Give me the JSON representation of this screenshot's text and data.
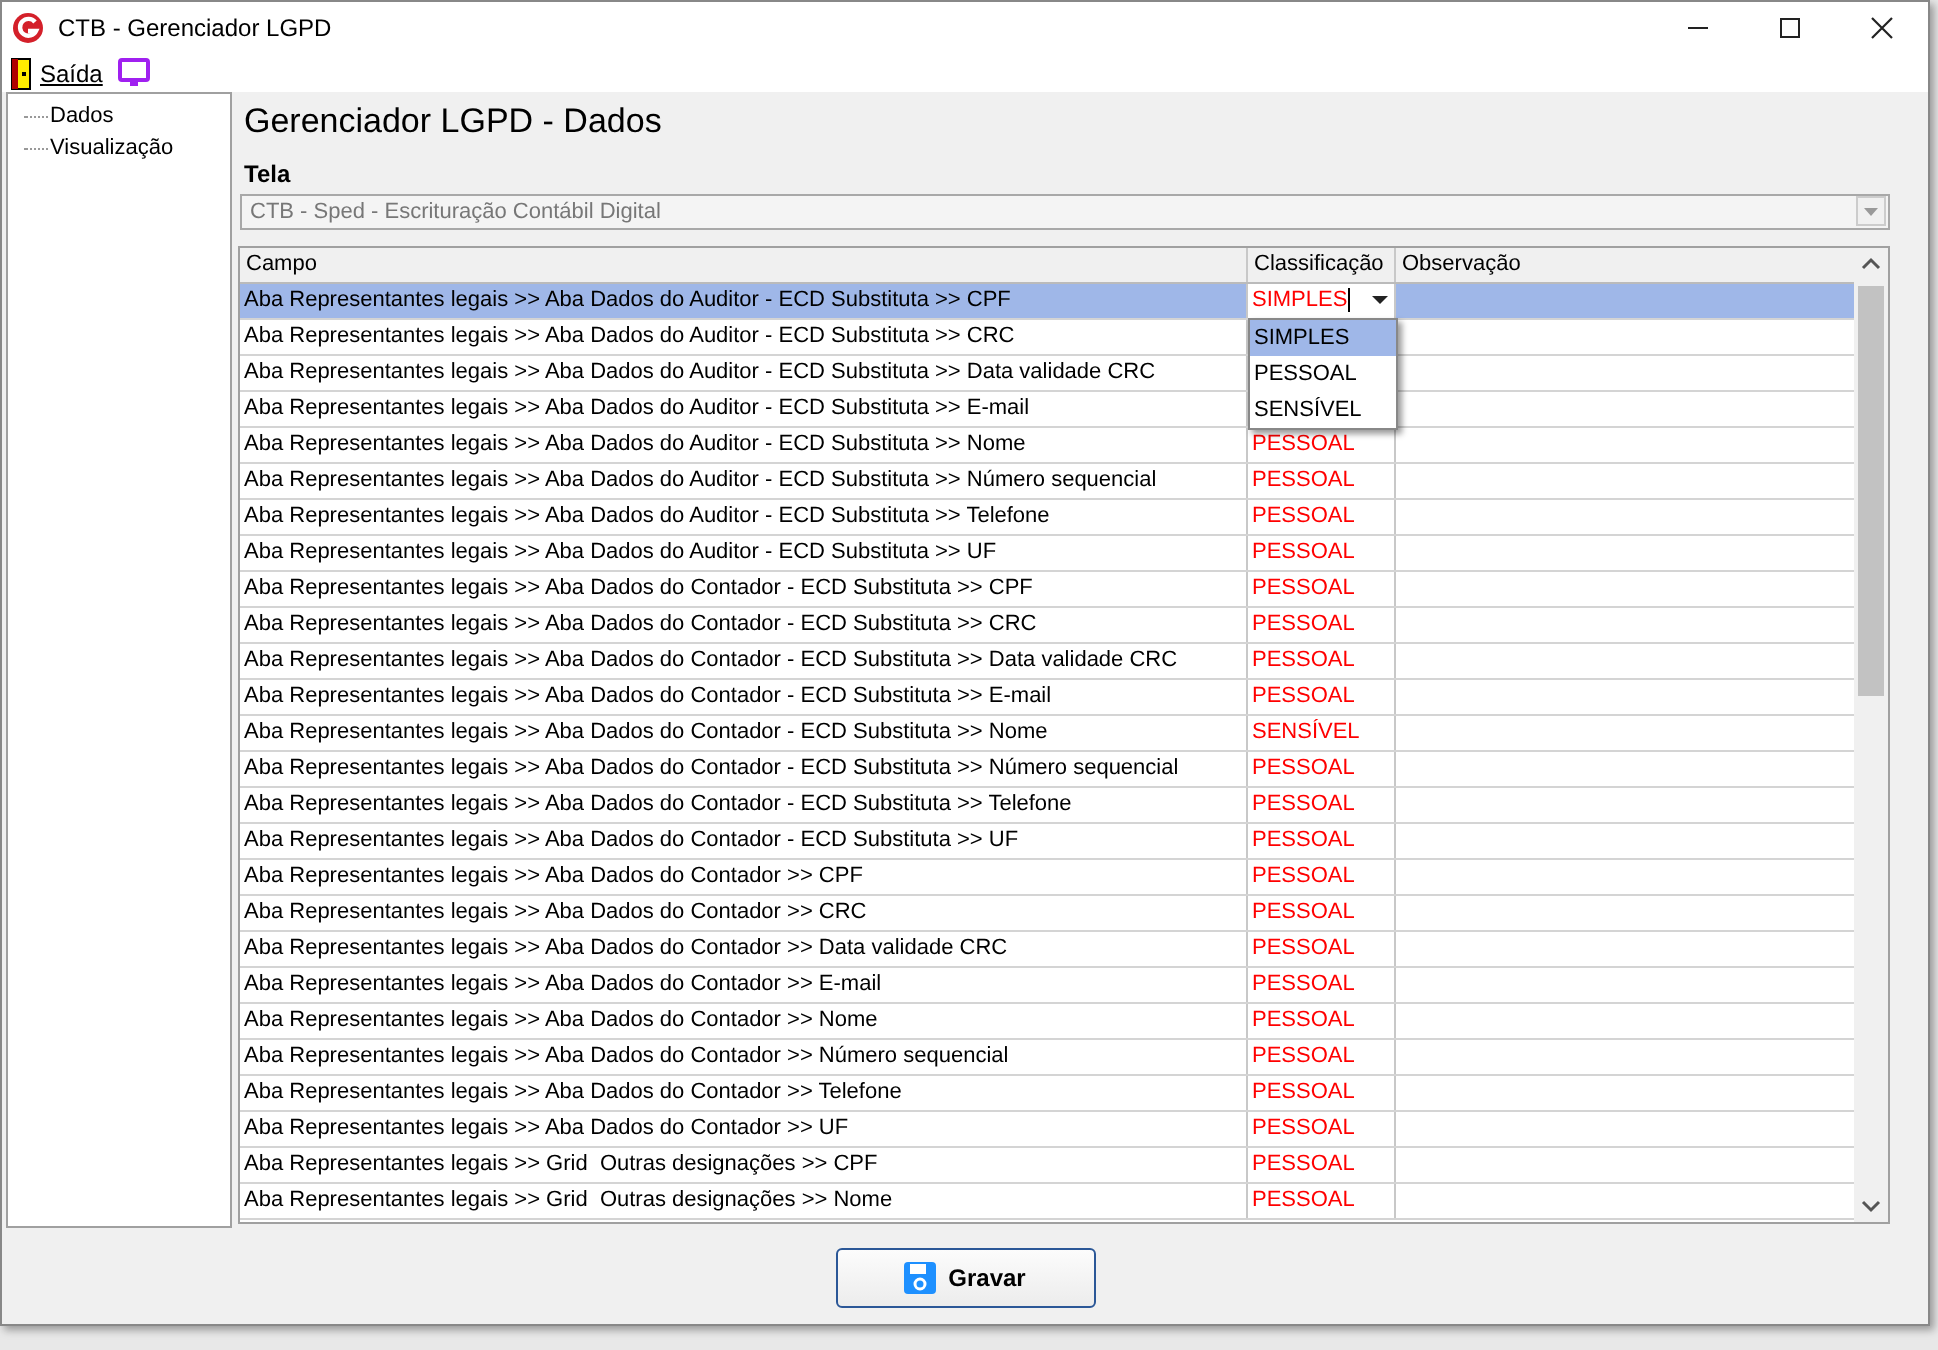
{
  "window": {
    "title": "CTB - Gerenciador LGPD"
  },
  "menu": [
    {
      "label": "Saída",
      "kind": "exit"
    },
    {
      "kind": "screen"
    }
  ],
  "sidebar": {
    "items": [
      {
        "label": "Dados",
        "selected": false
      },
      {
        "label": "Visualização",
        "selected": false
      }
    ]
  },
  "heading": "Gerenciador LGPD - Dados",
  "tela": {
    "label": "Tela",
    "value": "CTB - Sped - Escrituração Contábil Digital",
    "disabled": true
  },
  "table": {
    "columns": [
      "Campo",
      "Classificação",
      "Observação"
    ],
    "rows": [
      {
        "campo": "Aba Representantes legais >> Aba Dados do Auditor - ECD Substituta >> CPF",
        "selected": true,
        "editor": {
          "value": "SIMPLES",
          "options": [
            {
              "label": "SIMPLES",
              "selected": true
            },
            {
              "label": "PESSOAL",
              "selected": false
            },
            {
              "label": "SENSÍVEL",
              "selected": false
            }
          ]
        }
      },
      {
        "campo": "Aba Representantes legais >> Aba Dados do Auditor - ECD Substituta >> CRC",
        "selected": false
      },
      {
        "campo": "Aba Representantes legais >> Aba Dados do Auditor - ECD Substituta >> Data validade CRC",
        "selected": false
      },
      {
        "campo": "Aba Representantes legais >> Aba Dados do Auditor - ECD Substituta >> E-mail",
        "selected": false
      },
      {
        "campo": "Aba Representantes legais >> Aba Dados do Auditor - ECD Substituta >> Nome",
        "classificacao": "PESSOAL",
        "selected": false
      },
      {
        "campo": "Aba Representantes legais >> Aba Dados do Auditor - ECD Substituta >> Número sequencial",
        "classificacao": "PESSOAL",
        "selected": false
      },
      {
        "campo": "Aba Representantes legais >> Aba Dados do Auditor - ECD Substituta >> Telefone",
        "classificacao": "PESSOAL",
        "selected": false
      },
      {
        "campo": "Aba Representantes legais >> Aba Dados do Auditor - ECD Substituta >> UF",
        "classificacao": "PESSOAL",
        "selected": false
      },
      {
        "campo": "Aba Representantes legais >> Aba Dados do Contador - ECD Substituta >> CPF",
        "classificacao": "PESSOAL",
        "selected": false
      },
      {
        "campo": "Aba Representantes legais >> Aba Dados do Contador - ECD Substituta >> CRC",
        "classificacao": "PESSOAL",
        "selected": false
      },
      {
        "campo": "Aba Representantes legais >> Aba Dados do Contador - ECD Substituta >> Data validade CRC",
        "classificacao": "PESSOAL",
        "selected": false
      },
      {
        "campo": "Aba Representantes legais >> Aba Dados do Contador - ECD Substituta >> E-mail",
        "classificacao": "PESSOAL",
        "selected": false
      },
      {
        "campo": "Aba Representantes legais >> Aba Dados do Contador - ECD Substituta >> Nome",
        "classificacao": "SENSÍVEL",
        "selected": false
      },
      {
        "campo": "Aba Representantes legais >> Aba Dados do Contador - ECD Substituta >> Número sequencial",
        "classificacao": "PESSOAL",
        "selected": false
      },
      {
        "campo": "Aba Representantes legais >> Aba Dados do Contador - ECD Substituta >> Telefone",
        "classificacao": "PESSOAL",
        "selected": false
      },
      {
        "campo": "Aba Representantes legais >> Aba Dados do Contador - ECD Substituta >> UF",
        "classificacao": "PESSOAL",
        "selected": false
      },
      {
        "campo": "Aba Representantes legais >> Aba Dados do Contador >> CPF",
        "classificacao": "PESSOAL",
        "selected": false
      },
      {
        "campo": "Aba Representantes legais >> Aba Dados do Contador >> CRC",
        "classificacao": "PESSOAL",
        "selected": false
      },
      {
        "campo": "Aba Representantes legais >> Aba Dados do Contador >> Data validade CRC",
        "classificacao": "PESSOAL",
        "selected": false
      },
      {
        "campo": "Aba Representantes legais >> Aba Dados do Contador >> E-mail",
        "classificacao": "PESSOAL",
        "selected": false
      },
      {
        "campo": "Aba Representantes legais >> Aba Dados do Contador >> Nome",
        "classificacao": "PESSOAL",
        "selected": false
      },
      {
        "campo": "Aba Representantes legais >> Aba Dados do Contador >> Número sequencial",
        "classificacao": "PESSOAL",
        "selected": false
      },
      {
        "campo": "Aba Representantes legais >> Aba Dados do Contador >> Telefone",
        "classificacao": "PESSOAL",
        "selected": false
      },
      {
        "campo": "Aba Representantes legais >> Aba Dados do Contador >> UF",
        "classificacao": "PESSOAL",
        "selected": false
      },
      {
        "campo": "Aba Representantes legais >> Grid  Outras designações >> CPF",
        "classificacao": "PESSOAL",
        "selected": false
      },
      {
        "campo": "Aba Representantes legais >> Grid  Outras designações >> Nome",
        "classificacao": "PESSOAL",
        "selected": false
      }
    ]
  },
  "buttons": [
    {
      "label": "Gravar",
      "kind": "save"
    }
  ]
}
